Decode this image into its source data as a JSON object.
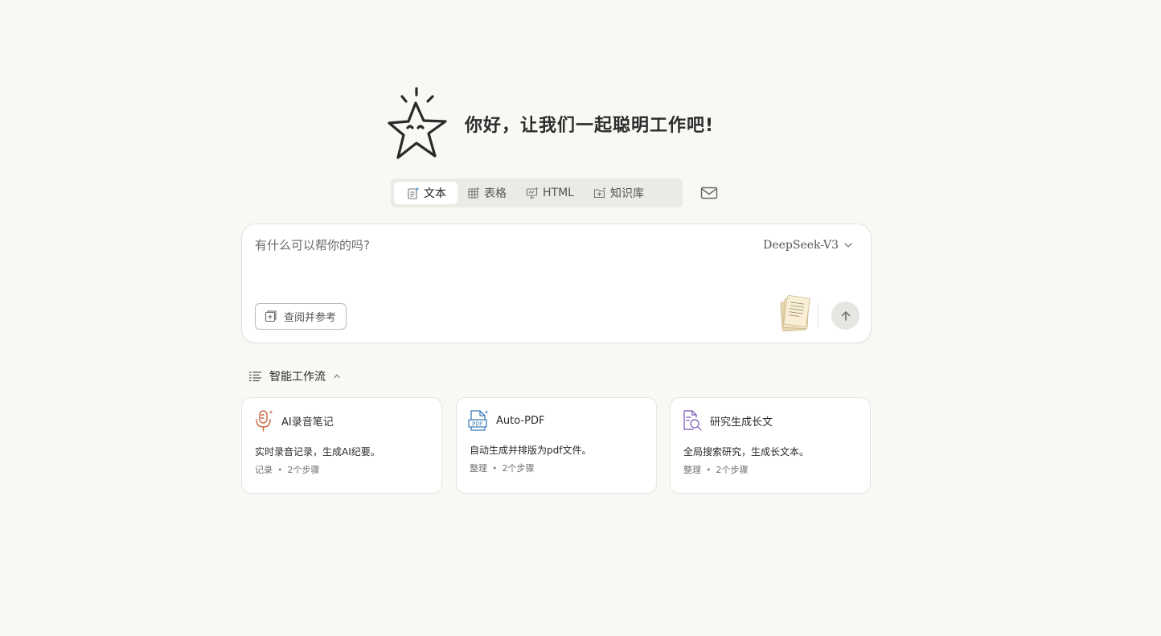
{
  "hero": {
    "title": "你好，让我们一起聪明工作吧!",
    "mascot_icon": "star-mascot"
  },
  "tabs": [
    {
      "label": "文本",
      "icon": "text-doc-icon",
      "active": true
    },
    {
      "label": "表格",
      "icon": "table-icon",
      "active": false
    },
    {
      "label": "HTML",
      "icon": "html-slide-icon",
      "active": false
    },
    {
      "label": "知识库",
      "icon": "folder-icon",
      "active": false
    }
  ],
  "mail_icon": "mail-icon",
  "input": {
    "placeholder": "有什么可以帮你的吗?",
    "value": "",
    "model": "DeepSeek-V3",
    "reference_button": "查阅并参考"
  },
  "workflow": {
    "title": "智能工作流",
    "cards": [
      {
        "title": "AI录音笔记",
        "desc": "实时录音记录，生成AI纪要。",
        "tag": "记录",
        "steps": "2个步骤",
        "icon": "microphone-icon",
        "accent": "#c8643c"
      },
      {
        "title": "Auto-PDF",
        "desc": "自动生成并排版为pdf文件。",
        "tag": "整理",
        "steps": "2个步骤",
        "icon": "pdf-icon",
        "accent": "#3d7bb8"
      },
      {
        "title": "研究生成长文",
        "desc": "全局搜索研究，生成长文本。",
        "tag": "整理",
        "steps": "2个步骤",
        "icon": "search-doc-icon",
        "accent": "#8a6cc4"
      }
    ]
  },
  "colors": {
    "background": "#f9f8f5",
    "card": "#ffffff",
    "tab_bg": "#eceae5"
  }
}
